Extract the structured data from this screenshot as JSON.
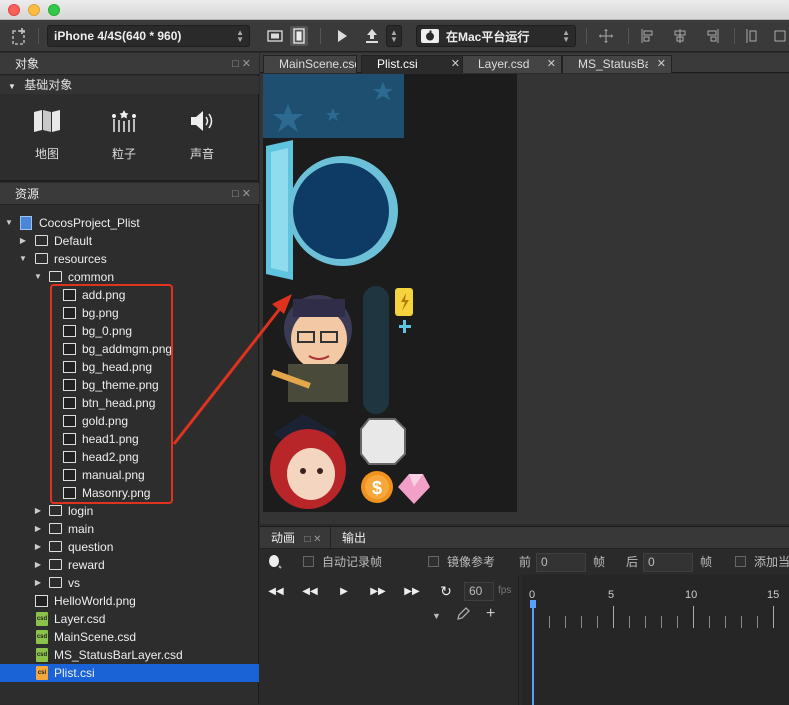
{
  "toolbar": {
    "device": "iPhone 4/4S(640 * 960)",
    "run_target": "在Mac平台运行"
  },
  "objects_panel": {
    "title": "对象",
    "section": "基础对象",
    "items": [
      {
        "label": "地图",
        "icon": "map-icon"
      },
      {
        "label": "粒子",
        "icon": "particle-icon"
      },
      {
        "label": "声音",
        "icon": "sound-icon"
      }
    ]
  },
  "resources_panel": {
    "title": "资源",
    "tree": [
      {
        "label": "CocosProject_Plist",
        "type": "project",
        "depth": 0,
        "expanded": true
      },
      {
        "label": "Default",
        "type": "folder",
        "depth": 1,
        "expanded": false
      },
      {
        "label": "resources",
        "type": "folder",
        "depth": 1,
        "expanded": true
      },
      {
        "label": "common",
        "type": "folder",
        "depth": 2,
        "expanded": true
      },
      {
        "label": "add.png",
        "type": "image",
        "depth": 3
      },
      {
        "label": "bg.png",
        "type": "image",
        "depth": 3
      },
      {
        "label": "bg_0.png",
        "type": "image",
        "depth": 3
      },
      {
        "label": "bg_addmgm.png",
        "type": "image",
        "depth": 3
      },
      {
        "label": "bg_head.png",
        "type": "image",
        "depth": 3
      },
      {
        "label": "bg_theme.png",
        "type": "image",
        "depth": 3
      },
      {
        "label": "btn_head.png",
        "type": "image",
        "depth": 3
      },
      {
        "label": "gold.png",
        "type": "image",
        "depth": 3
      },
      {
        "label": "head1.png",
        "type": "image",
        "depth": 3
      },
      {
        "label": "head2.png",
        "type": "image",
        "depth": 3
      },
      {
        "label": "manual.png",
        "type": "image",
        "depth": 3
      },
      {
        "label": "Masonry.png",
        "type": "image",
        "depth": 3
      },
      {
        "label": "login",
        "type": "folder",
        "depth": 2,
        "expanded": false
      },
      {
        "label": "main",
        "type": "folder",
        "depth": 2,
        "expanded": false
      },
      {
        "label": "question",
        "type": "folder",
        "depth": 2,
        "expanded": false
      },
      {
        "label": "reward",
        "type": "folder",
        "depth": 2,
        "expanded": false
      },
      {
        "label": "vs",
        "type": "folder",
        "depth": 2,
        "expanded": false
      },
      {
        "label": "HelloWorld.png",
        "type": "image",
        "depth": 1
      },
      {
        "label": "Layer.csd",
        "type": "csd",
        "depth": 1
      },
      {
        "label": "MainScene.csd",
        "type": "csd",
        "depth": 1
      },
      {
        "label": "MS_StatusBarLayer.csd",
        "type": "csd",
        "depth": 1
      },
      {
        "label": "Plist.csi",
        "type": "csi",
        "depth": 1,
        "selected": true
      }
    ]
  },
  "editor_tabs": [
    {
      "label": "MainScene.csd",
      "active": false
    },
    {
      "label": "Plist.csi",
      "active": true
    },
    {
      "label": "Layer.csd",
      "active": false
    },
    {
      "label": "MS_StatusBarLayer.csd",
      "active": false
    }
  ],
  "bottom_panel": {
    "tabs": [
      "动画",
      "输出"
    ],
    "auto_record": "自动记录帧",
    "onion_skin": "镜像参考",
    "before_label": "前",
    "before_value": "0",
    "frame_unit": "帧",
    "after_label": "后",
    "after_value": "0",
    "add_label": "添加当",
    "fps_value": "60",
    "fps_unit": "fps",
    "timeline_ticks": [
      "0",
      "5",
      "10",
      "15"
    ]
  },
  "colors": {
    "selection": "#1a63d7",
    "highlight_box": "#e0331f",
    "arrow": "#e0331f"
  }
}
